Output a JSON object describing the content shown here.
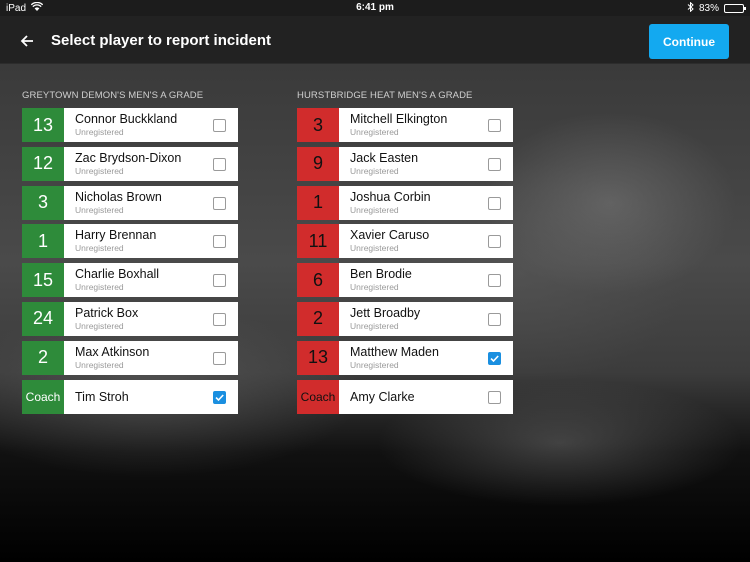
{
  "status": {
    "device": "iPad",
    "time": "6:41 pm",
    "battery": "83%"
  },
  "header": {
    "title": "Select player to report incident",
    "continue_label": "Continue"
  },
  "teams": [
    {
      "name": "GREYTOWN DEMON'S MEN'S A GRADE",
      "players": [
        {
          "number": "13",
          "name": "Connor Buckkland",
          "status": "Unregistered",
          "checked": false
        },
        {
          "number": "12",
          "name": "Zac Brydson-Dixon",
          "status": "Unregistered",
          "checked": false
        },
        {
          "number": "3",
          "name": "Nicholas Brown",
          "status": "Unregistered",
          "checked": false
        },
        {
          "number": "1",
          "name": "Harry Brennan",
          "status": "Unregistered",
          "checked": false
        },
        {
          "number": "15",
          "name": "Charlie Boxhall",
          "status": "Unregistered",
          "checked": false
        },
        {
          "number": "24",
          "name": "Patrick Box",
          "status": "Unregistered",
          "checked": false
        },
        {
          "number": "2",
          "name": "Max Atkinson",
          "status": "Unregistered",
          "checked": false
        },
        {
          "number": "Coach",
          "name": "Tim Stroh",
          "status": "",
          "checked": true
        }
      ]
    },
    {
      "name": "HURSTBRIDGE HEAT MEN'S A GRADE",
      "players": [
        {
          "number": "3",
          "name": "Mitchell Elkington",
          "status": "Unregistered",
          "checked": false
        },
        {
          "number": "9",
          "name": "Jack Easten",
          "status": "Unregistered",
          "checked": false
        },
        {
          "number": "1",
          "name": "Joshua Corbin",
          "status": "Unregistered",
          "checked": false
        },
        {
          "number": "11",
          "name": "Xavier Caruso",
          "status": "Unregistered",
          "checked": false
        },
        {
          "number": "6",
          "name": "Ben Brodie",
          "status": "Unregistered",
          "checked": false
        },
        {
          "number": "2",
          "name": "Jett Broadby",
          "status": "Unregistered",
          "checked": false
        },
        {
          "number": "13",
          "name": "Matthew Maden",
          "status": "Unregistered",
          "checked": true
        },
        {
          "number": "Coach",
          "name": "Amy Clarke",
          "status": "",
          "checked": false
        }
      ]
    }
  ],
  "colors": {
    "home": "#2e8b3a",
    "away": "#d12c2c",
    "accent": "#13a9f0"
  },
  "icons": {
    "back": "arrow-left-icon",
    "wifi": "wifi-icon",
    "bluetooth": "bluetooth-icon",
    "battery": "battery-icon"
  }
}
